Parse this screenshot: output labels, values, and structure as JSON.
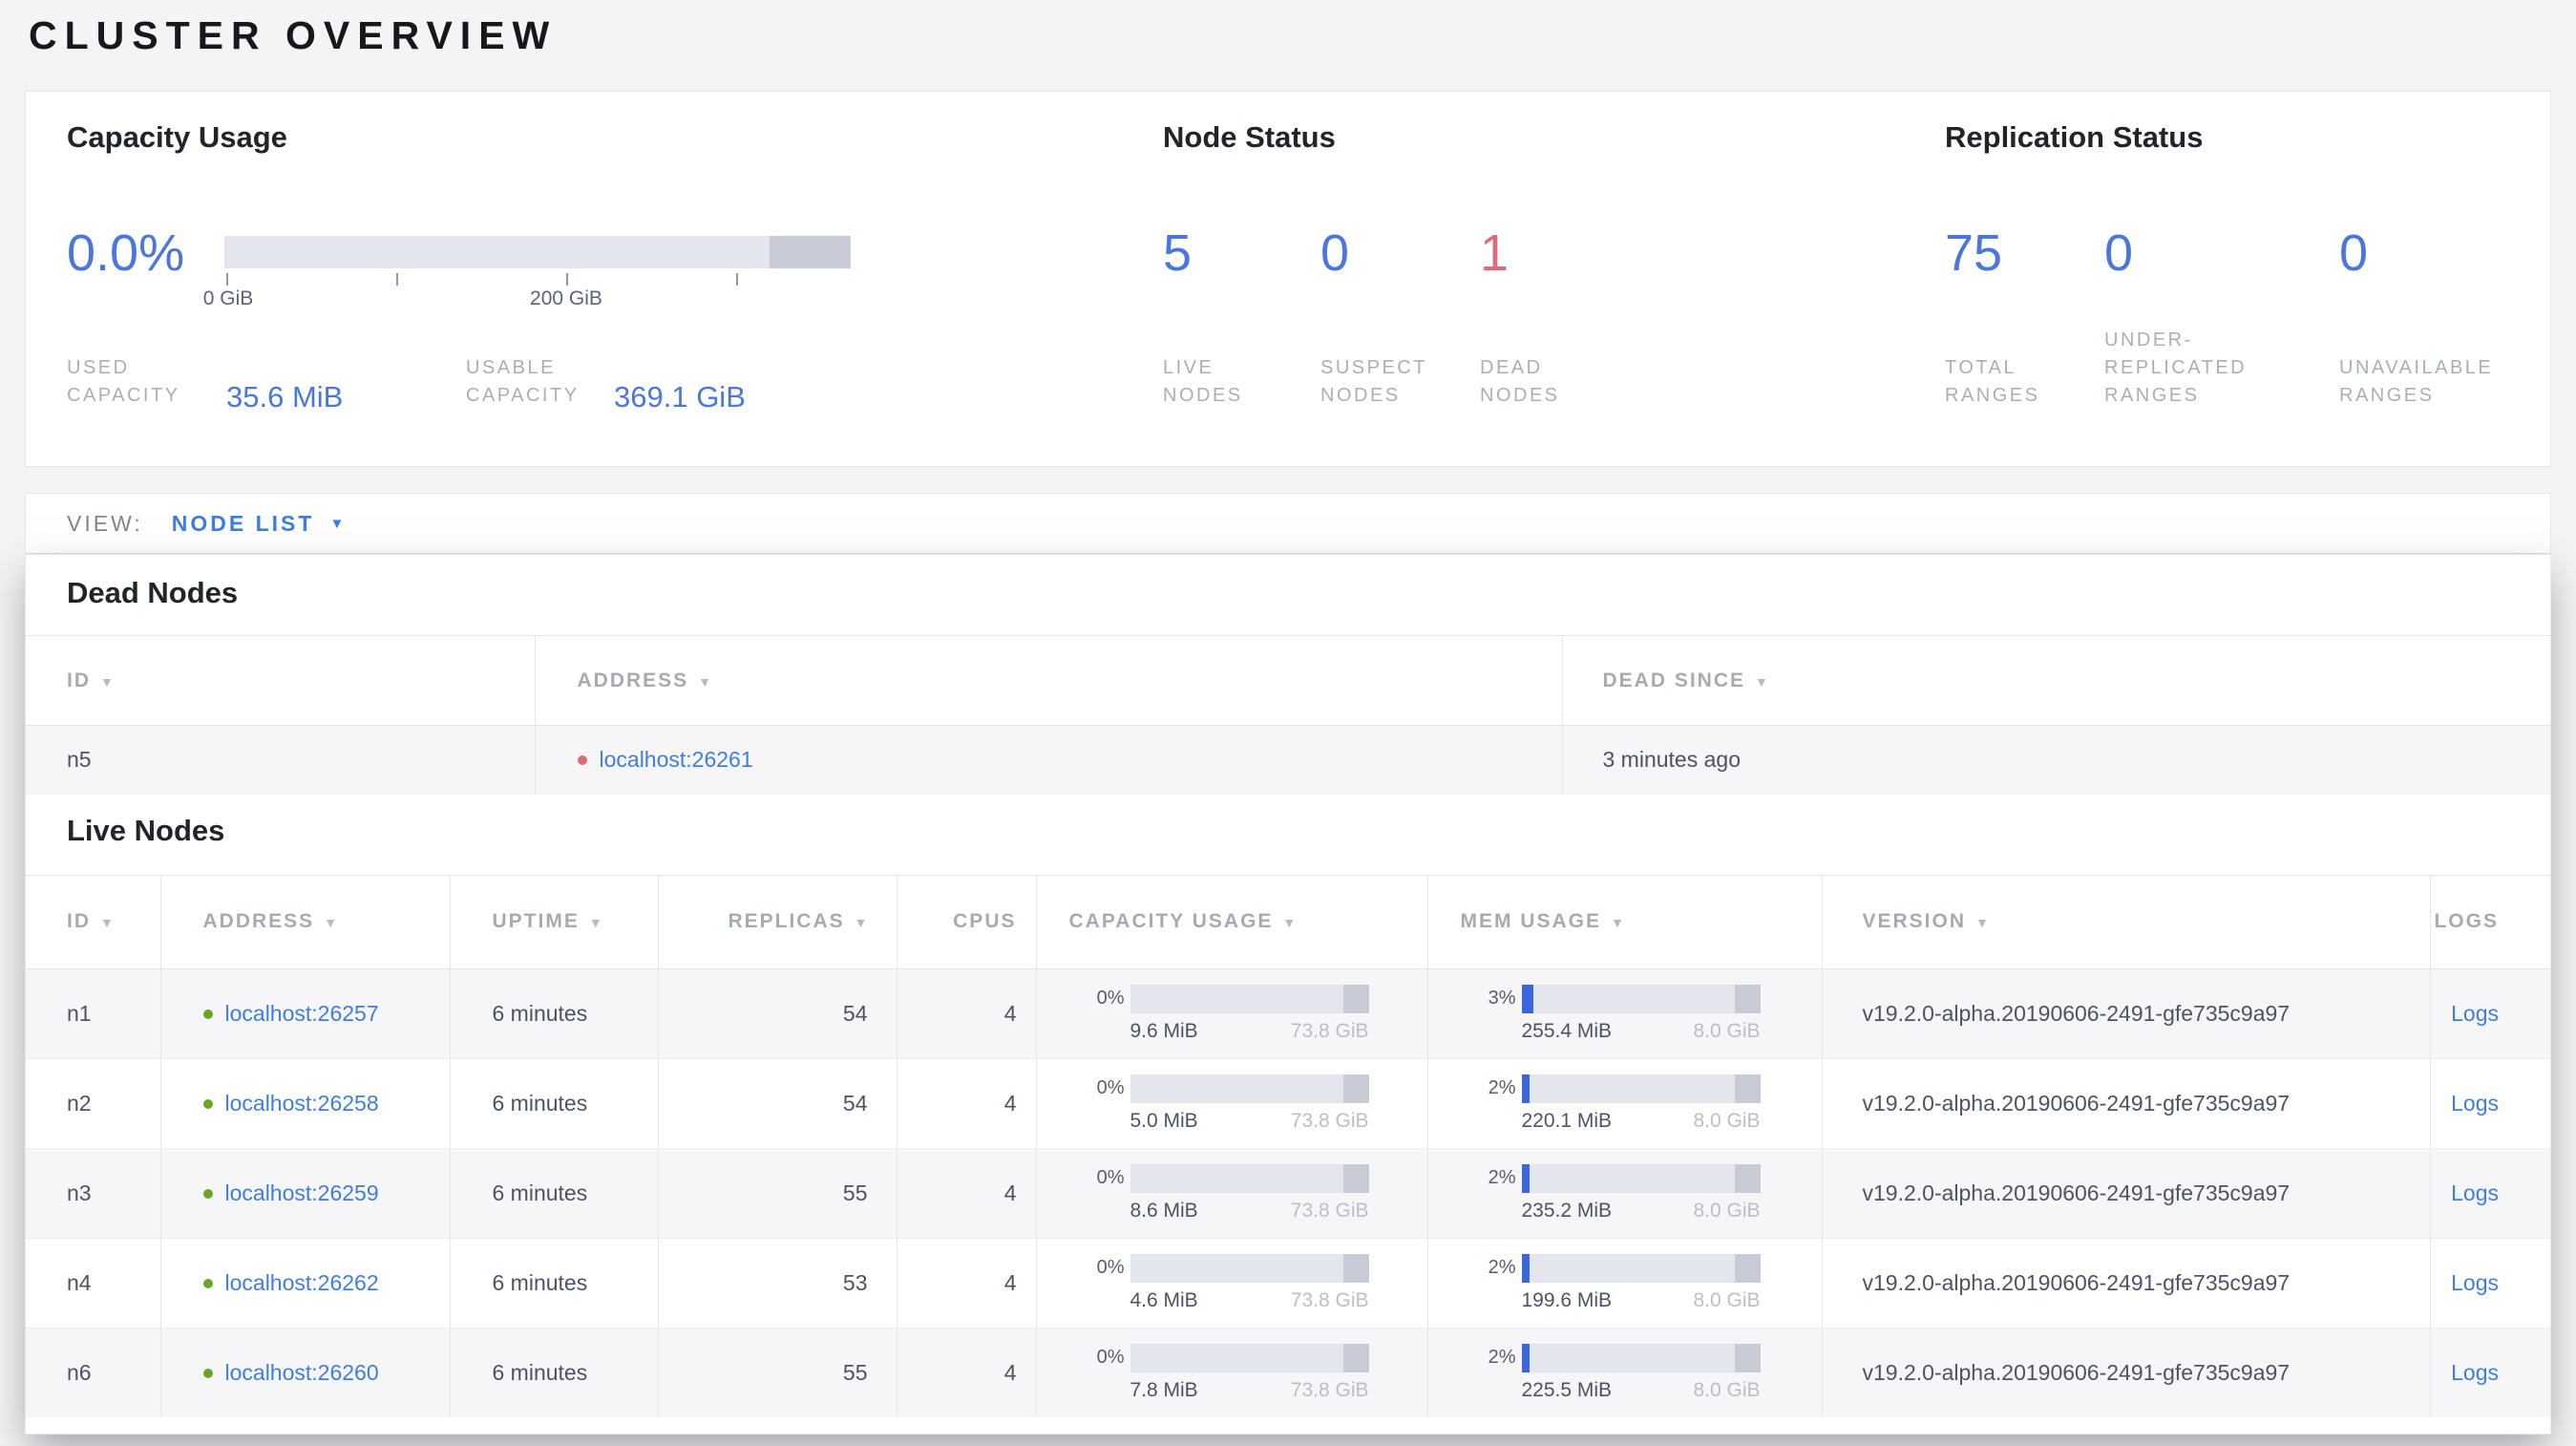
{
  "page": {
    "title": "CLUSTER OVERVIEW"
  },
  "colors": {
    "accent": "#4a76dd",
    "danger": "#e06a7c",
    "link": "#3f7de0",
    "live_dot": "#67a723",
    "dead_dot": "#e0696b",
    "bar_track": "#e3e6ec",
    "bar_dark": "#c6cbd6",
    "bar_fill": "#3c66dc"
  },
  "summary": {
    "capacity": {
      "title": "Capacity Usage",
      "percent": "0.0%",
      "axis": {
        "t0": "0 GiB",
        "t2": "200 GiB"
      },
      "stats": [
        {
          "label_lines": [
            "USED",
            "CAPACITY"
          ],
          "value": "35.6 MiB"
        },
        {
          "label_lines": [
            "USABLE",
            "CAPACITY"
          ],
          "value": "369.1 GiB"
        }
      ]
    },
    "nodes": {
      "title": "Node Status",
      "stats": [
        {
          "value": "5",
          "label_lines": [
            "LIVE",
            "NODES"
          ],
          "tone": "blue"
        },
        {
          "value": "0",
          "label_lines": [
            "SUSPECT",
            "NODES"
          ],
          "tone": "blue"
        },
        {
          "value": "1",
          "label_lines": [
            "DEAD",
            "NODES"
          ],
          "tone": "red"
        }
      ]
    },
    "replication": {
      "title": "Replication Status",
      "stats": [
        {
          "value": "75",
          "label_lines": [
            "TOTAL",
            "RANGES"
          ]
        },
        {
          "value": "0",
          "label_lines": [
            "UNDER-",
            "REPLICATED",
            "RANGES"
          ]
        },
        {
          "value": "0",
          "label_lines": [
            "UNAVAILABLE",
            "RANGES"
          ]
        }
      ]
    }
  },
  "view_bar": {
    "label": "VIEW:",
    "selected": "NODE LIST"
  },
  "dead_nodes": {
    "heading": "Dead Nodes",
    "columns": [
      {
        "label": "ID"
      },
      {
        "label": "ADDRESS"
      },
      {
        "label": "DEAD SINCE"
      }
    ],
    "rows": [
      {
        "id": "n5",
        "address": "localhost:26261",
        "dead_since": "3 minutes ago"
      }
    ]
  },
  "live_nodes": {
    "heading": "Live Nodes",
    "columns": [
      {
        "label": "ID"
      },
      {
        "label": "ADDRESS"
      },
      {
        "label": "UPTIME"
      },
      {
        "label": "REPLICAS"
      },
      {
        "label": "CPUS"
      },
      {
        "label": "CAPACITY USAGE"
      },
      {
        "label": "MEM USAGE"
      },
      {
        "label": "VERSION"
      },
      {
        "label": "LOGS"
      }
    ],
    "rows": [
      {
        "id": "n1",
        "address": "localhost:26257",
        "uptime": "6 minutes",
        "replicas": "54",
        "cpus": "4",
        "capacity": {
          "pct": "0%",
          "pct_num": 0,
          "used": "9.6 MiB",
          "total": "73.8 GiB"
        },
        "memory": {
          "pct": "3%",
          "pct_num": 3,
          "used": "255.4 MiB",
          "total": "8.0 GiB"
        },
        "version": "v19.2.0-alpha.20190606-2491-gfe735c9a97",
        "logs": "Logs"
      },
      {
        "id": "n2",
        "address": "localhost:26258",
        "uptime": "6 minutes",
        "replicas": "54",
        "cpus": "4",
        "capacity": {
          "pct": "0%",
          "pct_num": 0,
          "used": "5.0 MiB",
          "total": "73.8 GiB"
        },
        "memory": {
          "pct": "2%",
          "pct_num": 2,
          "used": "220.1 MiB",
          "total": "8.0 GiB"
        },
        "version": "v19.2.0-alpha.20190606-2491-gfe735c9a97",
        "logs": "Logs"
      },
      {
        "id": "n3",
        "address": "localhost:26259",
        "uptime": "6 minutes",
        "replicas": "55",
        "cpus": "4",
        "capacity": {
          "pct": "0%",
          "pct_num": 0,
          "used": "8.6 MiB",
          "total": "73.8 GiB"
        },
        "memory": {
          "pct": "2%",
          "pct_num": 2,
          "used": "235.2 MiB",
          "total": "8.0 GiB"
        },
        "version": "v19.2.0-alpha.20190606-2491-gfe735c9a97",
        "logs": "Logs"
      },
      {
        "id": "n4",
        "address": "localhost:26262",
        "uptime": "6 minutes",
        "replicas": "53",
        "cpus": "4",
        "capacity": {
          "pct": "0%",
          "pct_num": 0,
          "used": "4.6 MiB",
          "total": "73.8 GiB"
        },
        "memory": {
          "pct": "2%",
          "pct_num": 2,
          "used": "199.6 MiB",
          "total": "8.0 GiB"
        },
        "version": "v19.2.0-alpha.20190606-2491-gfe735c9a97",
        "logs": "Logs"
      },
      {
        "id": "n6",
        "address": "localhost:26260",
        "uptime": "6 minutes",
        "replicas": "55",
        "cpus": "4",
        "capacity": {
          "pct": "0%",
          "pct_num": 0,
          "used": "7.8 MiB",
          "total": "73.8 GiB"
        },
        "memory": {
          "pct": "2%",
          "pct_num": 2,
          "used": "225.5 MiB",
          "total": "8.0 GiB"
        },
        "version": "v19.2.0-alpha.20190606-2491-gfe735c9a97",
        "logs": "Logs"
      }
    ]
  }
}
